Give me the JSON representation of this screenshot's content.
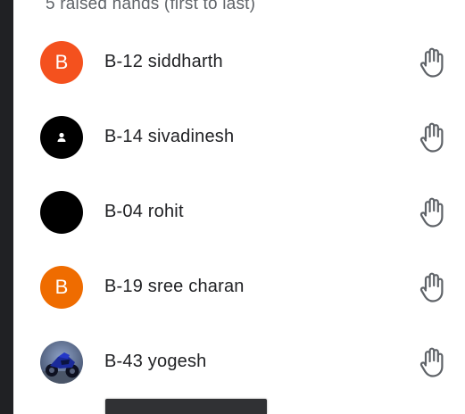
{
  "panel": {
    "header": "5 raised hands (first to last)"
  },
  "participants": [
    {
      "name": "B-12 siddharth",
      "avatar_type": "initial",
      "initial": "B",
      "avatar_color": "#f4511e"
    },
    {
      "name": "B-14 sivadinesh",
      "avatar_type": "person-icon",
      "initial": "",
      "avatar_color": "#000000"
    },
    {
      "name": "B-04 rohit",
      "avatar_type": "blank",
      "initial": "",
      "avatar_color": "#000000"
    },
    {
      "name": "B-19 sree charan",
      "avatar_type": "initial",
      "initial": "B",
      "avatar_color": "#ef6c00"
    },
    {
      "name": "B-43 yogesh",
      "avatar_type": "photo",
      "initial": "",
      "avatar_color": "#3d4a66"
    }
  ],
  "icons": {
    "raised_hand": "raised-hand-icon",
    "person": "person-icon"
  },
  "colors": {
    "rail": "#202124",
    "text": "#202124",
    "muted": "#5f6368"
  }
}
